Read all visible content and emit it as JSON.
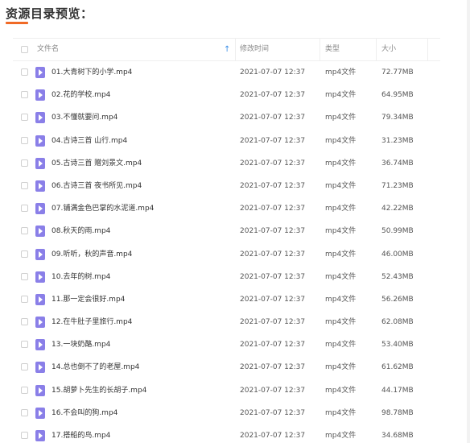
{
  "page": {
    "title": "资源目录预览："
  },
  "colors": {
    "accent": "#f06a26",
    "file_icon": "#8a7fe8",
    "sort_arrow": "#3b8fe8"
  },
  "table": {
    "headers": {
      "name": "文件名",
      "time": "修改时间",
      "type": "类型",
      "size": "大小"
    },
    "rows": [
      {
        "name": "01.大青树下的小学.mp4",
        "time": "2021-07-07 12:37",
        "type": "mp4文件",
        "size": "72.77MB"
      },
      {
        "name": "02.花的学校.mp4",
        "time": "2021-07-07 12:37",
        "type": "mp4文件",
        "size": "64.95MB"
      },
      {
        "name": "03.不懂就要问.mp4",
        "time": "2021-07-07 12:37",
        "type": "mp4文件",
        "size": "79.34MB"
      },
      {
        "name": "04.古诗三首 山行.mp4",
        "time": "2021-07-07 12:37",
        "type": "mp4文件",
        "size": "31.23MB"
      },
      {
        "name": "05.古诗三首 赠刘景文.mp4",
        "time": "2021-07-07 12:37",
        "type": "mp4文件",
        "size": "36.74MB"
      },
      {
        "name": "06.古诗三首 夜书所见.mp4",
        "time": "2021-07-07 12:37",
        "type": "mp4文件",
        "size": "71.23MB"
      },
      {
        "name": "07.铺满金色巴掌的水泥道.mp4",
        "time": "2021-07-07 12:37",
        "type": "mp4文件",
        "size": "42.22MB"
      },
      {
        "name": "08.秋天的雨.mp4",
        "time": "2021-07-07 12:37",
        "type": "mp4文件",
        "size": "50.99MB"
      },
      {
        "name": "09.听听，秋的声音.mp4",
        "time": "2021-07-07 12:37",
        "type": "mp4文件",
        "size": "46.00MB"
      },
      {
        "name": "10.去年的树.mp4",
        "time": "2021-07-07 12:37",
        "type": "mp4文件",
        "size": "52.43MB"
      },
      {
        "name": "11.那一定会很好.mp4",
        "time": "2021-07-07 12:37",
        "type": "mp4文件",
        "size": "56.26MB"
      },
      {
        "name": "12.在牛肚子里旅行.mp4",
        "time": "2021-07-07 12:37",
        "type": "mp4文件",
        "size": "62.08MB"
      },
      {
        "name": "13.一块奶酪.mp4",
        "time": "2021-07-07 12:37",
        "type": "mp4文件",
        "size": "53.40MB"
      },
      {
        "name": "14.总也倒不了的老屋.mp4",
        "time": "2021-07-07 12:37",
        "type": "mp4文件",
        "size": "61.62MB"
      },
      {
        "name": "15.胡萝卜先生的长胡子.mp4",
        "time": "2021-07-07 12:37",
        "type": "mp4文件",
        "size": "44.17MB"
      },
      {
        "name": "16.不会叫的狗.mp4",
        "time": "2021-07-07 12:37",
        "type": "mp4文件",
        "size": "98.78MB"
      },
      {
        "name": "17.搭船的鸟.mp4",
        "time": "2021-07-07 12:37",
        "type": "mp4文件",
        "size": "34.68MB"
      }
    ]
  }
}
